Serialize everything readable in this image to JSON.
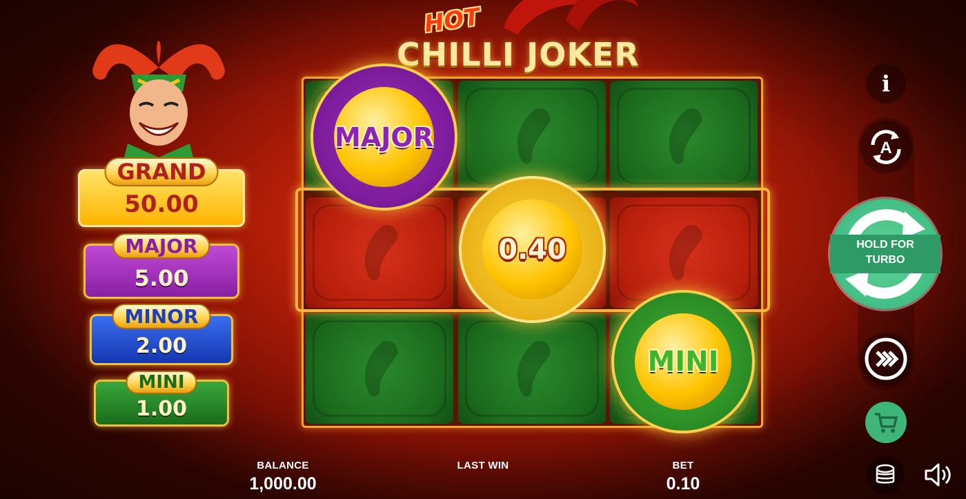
{
  "game": {
    "logo_hot": "HOT",
    "logo_title": "CHILLI JOKER"
  },
  "jackpots": [
    {
      "name": "GRAND",
      "value": "50.00"
    },
    {
      "name": "MAJOR",
      "value": "5.00"
    },
    {
      "name": "MINOR",
      "value": "2.00"
    },
    {
      "name": "MINI",
      "value": "1.00"
    }
  ],
  "reels": {
    "rows": [
      [
        "green",
        "green",
        "green"
      ],
      [
        "red",
        "red",
        "red"
      ],
      [
        "green",
        "green",
        "green"
      ]
    ],
    "coins": [
      {
        "label": "MAJOR",
        "color": "#8f22b6"
      },
      {
        "label": "0.40",
        "color": "#ffc400"
      },
      {
        "label": "MINI",
        "color": "#3fb52e"
      }
    ]
  },
  "controls": {
    "info_label": "i",
    "spin_label_line1": "HOLD FOR",
    "spin_label_line2": "TURBO",
    "autoplay_letter": "A"
  },
  "stats": {
    "balance_label": "BALANCE",
    "balance_value": "1,000.00",
    "lastwin_label": "LAST WIN",
    "lastwin_value": "",
    "bet_label": "BET",
    "bet_value": "0.10"
  },
  "colors": {
    "background": "#b81f08",
    "spin_button": "#36b57a",
    "reel_frame": "#f5a72a"
  }
}
